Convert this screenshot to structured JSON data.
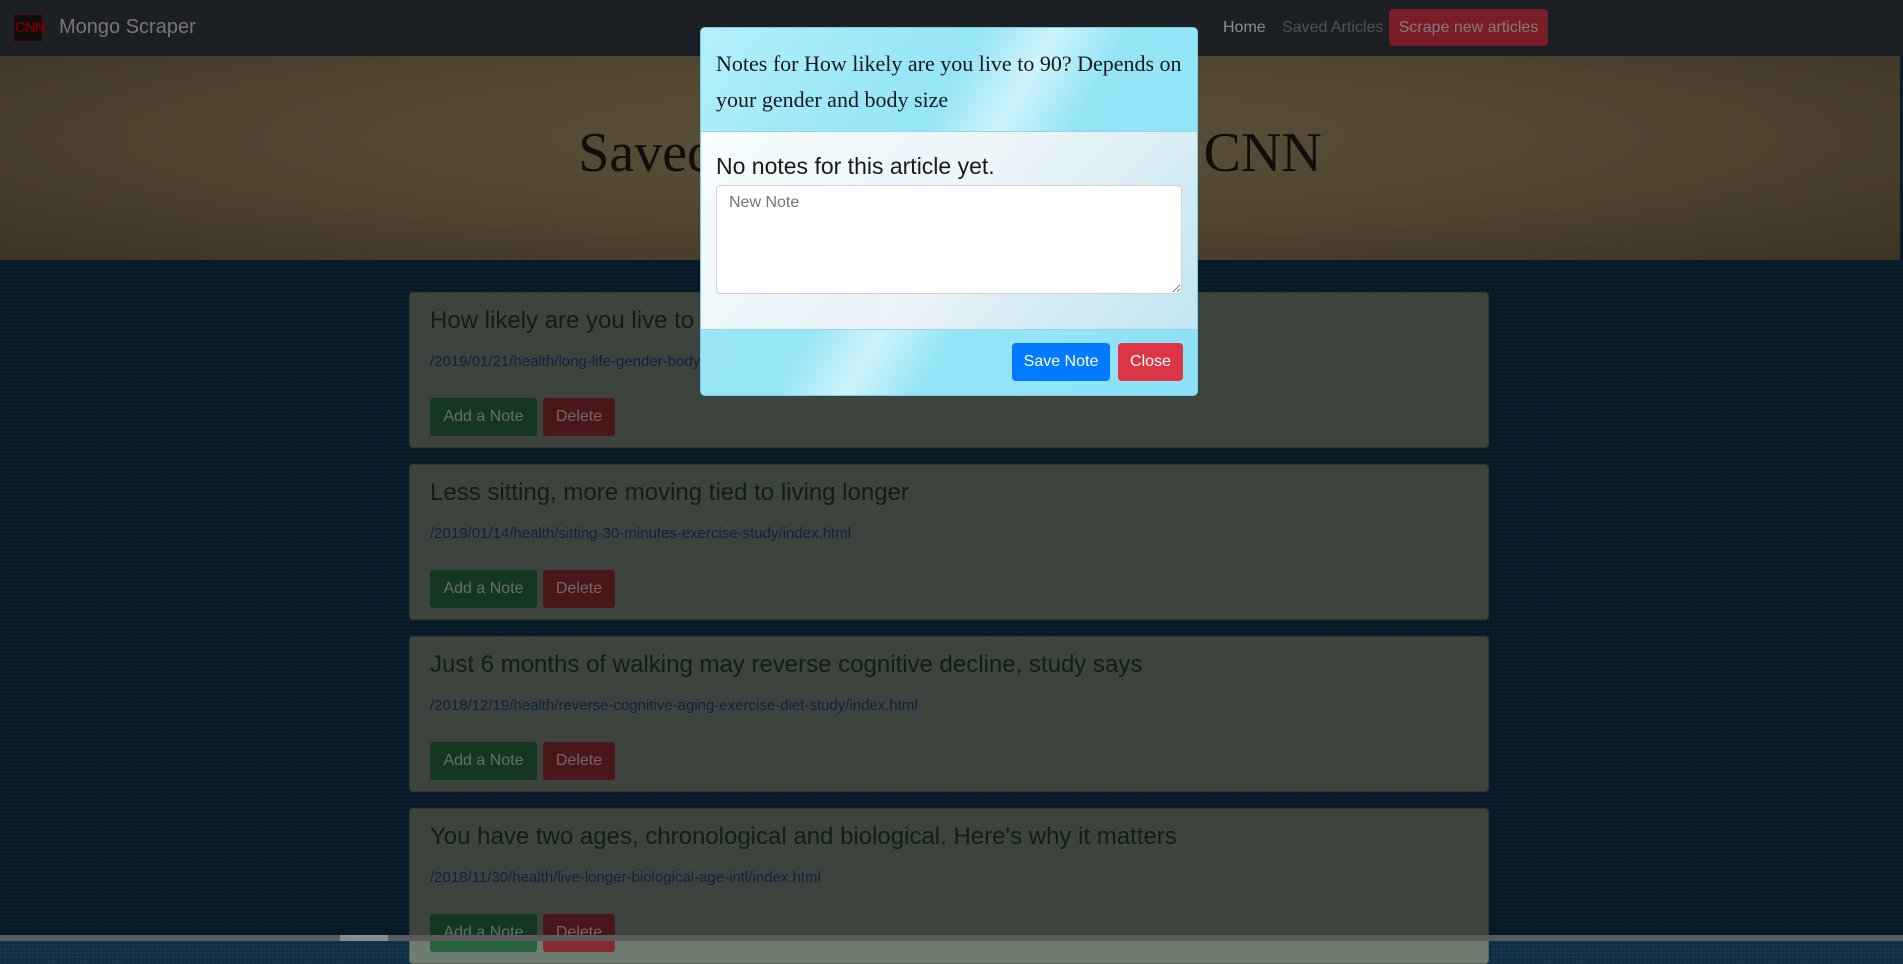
{
  "navbar": {
    "logo_text": "CNN",
    "brand": "Mongo Scraper",
    "home_label": "Home",
    "saved_label": "Saved Articles",
    "scrape_label": "Scrape new articles"
  },
  "jumbotron": {
    "title": "Saved Living Articles from CNN"
  },
  "articles": [
    {
      "title": "How likely are you live to 90? Depends on your gender and body size",
      "link": "/2019/01/21/health/long-life-gender-body-size-study/index.html",
      "note_label": "Add a Note",
      "delete_label": "Delete"
    },
    {
      "title": "Less sitting, more moving tied to living longer",
      "link": "/2019/01/14/health/sitting-30-minutes-exercise-study/index.html",
      "note_label": "Add a Note",
      "delete_label": "Delete"
    },
    {
      "title": "Just 6 months of walking may reverse cognitive decline, study says",
      "link": "/2018/12/19/health/reverse-cognitive-aging-exercise-diet-study/index.html",
      "note_label": "Add a Note",
      "delete_label": "Delete"
    },
    {
      "title": "You have two ages, chronological and biological. Here's why it matters",
      "link": "/2018/11/30/health/live-longer-biological-age-intl/index.html",
      "note_label": "Add a Note",
      "delete_label": "Delete"
    }
  ],
  "modal": {
    "title": "Notes for How likely are you live to 90? Depends on your gender and body size",
    "body_title": "No notes for this article yet.",
    "note_placeholder": "New Note",
    "save_label": "Save Note",
    "close_label": "Close"
  },
  "colors": {
    "navbar": "#343a40",
    "primary": "#007bff",
    "danger": "#dc3545",
    "success": "#28a745"
  }
}
